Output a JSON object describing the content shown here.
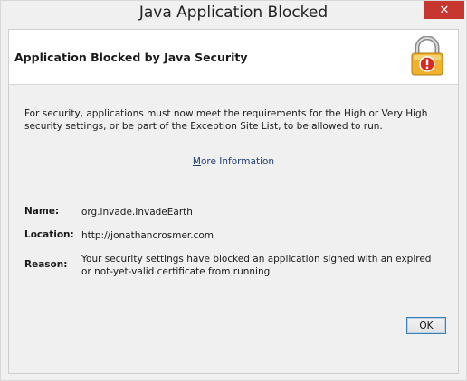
{
  "window": {
    "title": "Java Application Blocked",
    "close_glyph": "✕"
  },
  "banner": {
    "title": "Application Blocked by Java Security",
    "icon": "padlock-warning-icon"
  },
  "body": {
    "message": "For security, applications must now meet the requirements for the High or Very High security settings, or be part of the Exception Site List, to be allowed to run.",
    "more_info_first": "M",
    "more_info_rest": "ore Information"
  },
  "details": [
    {
      "label": "Name:",
      "value": "org.invade.InvadeEarth"
    },
    {
      "label": "Location:",
      "value": "http://jonathancrosmer.com"
    },
    {
      "label": "Reason:",
      "value": "Your security settings have blocked an application signed with an expired or not-yet-valid certificate from running"
    }
  ],
  "buttons": {
    "ok": "OK"
  },
  "colors": {
    "close": "#c7372f",
    "lock_body": "#f0b22e",
    "warning": "#d62a20"
  }
}
